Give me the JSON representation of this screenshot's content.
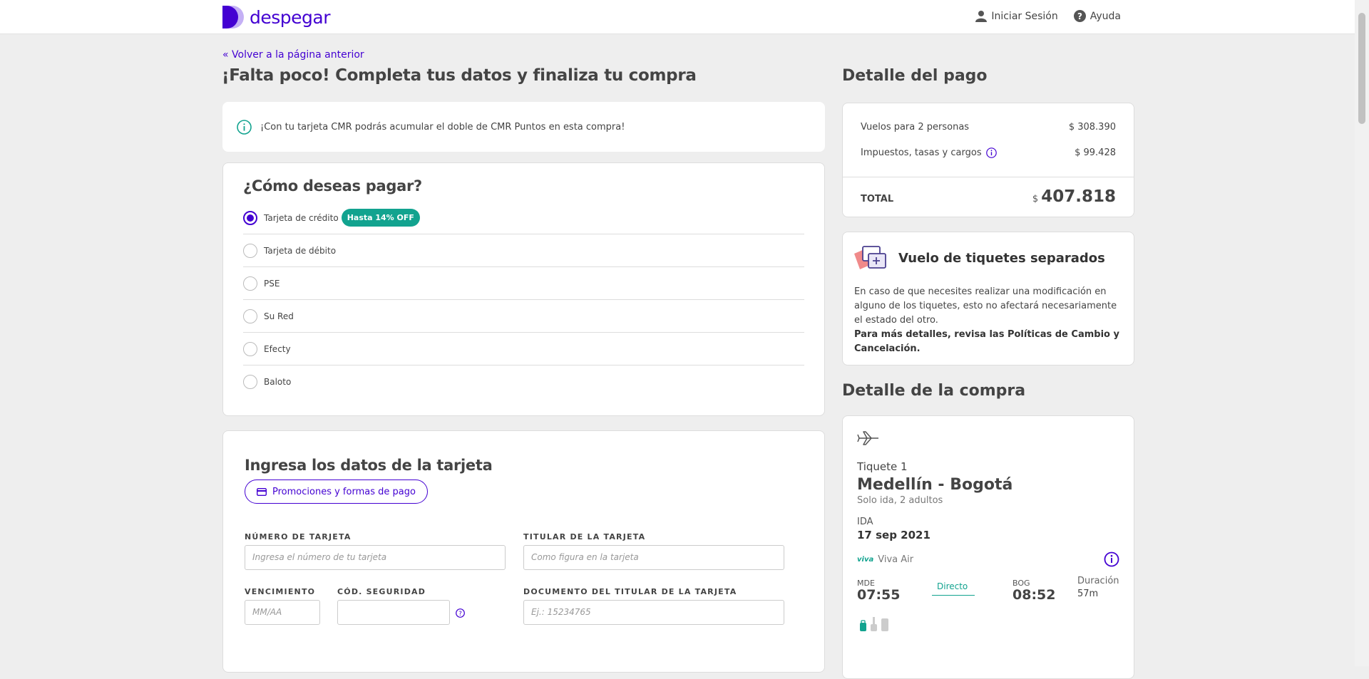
{
  "header": {
    "brand": "despegar",
    "login_label": "Iniciar Sesión",
    "help_label": "Ayuda"
  },
  "back_link": "« Volver a la página anterior",
  "page_title": "¡Falta poco! Completa tus datos y finaliza tu compra",
  "info_banner": "¡Con tu tarjeta CMR podrás acumular el doble de CMR Puntos en esta compra!",
  "payment": {
    "title": "¿Cómo deseas pagar?",
    "options": [
      {
        "label": "Tarjeta de crédito",
        "badge": "Hasta 14% OFF",
        "selected": true
      },
      {
        "label": "Tarjeta de débito",
        "selected": false
      },
      {
        "label": "PSE",
        "selected": false
      },
      {
        "label": "Su Red",
        "selected": false
      },
      {
        "label": "Efecty",
        "selected": false
      },
      {
        "label": "Baloto",
        "selected": false
      }
    ]
  },
  "card_form": {
    "title": "Ingresa los datos de la tarjeta",
    "promo_button": "Promociones y formas de pago",
    "card_number": {
      "label": "NÚMERO DE TARJETA",
      "placeholder": "Ingresa el número de tu tarjeta"
    },
    "holder": {
      "label": "TITULAR DE LA TARJETA",
      "placeholder": "Como figura en la tarjeta"
    },
    "expiry": {
      "label": "VENCIMIENTO",
      "placeholder": "MM/AA"
    },
    "security": {
      "label": "CÓD. SEGURIDAD",
      "placeholder": ""
    },
    "document": {
      "label": "DOCUMENTO DEL TITULAR DE LA TARJETA",
      "placeholder": "Ej.: 15234765"
    }
  },
  "payment_detail": {
    "title": "Detalle del pago",
    "flights_label": "Vuelos para 2 personas",
    "flights_value": "$ 308.390",
    "taxes_label": "Impuestos, tasas y cargos",
    "taxes_value": "$ 99.428",
    "total_label": "TOTAL",
    "total_currency": "$",
    "total_value": "407.818"
  },
  "separate_tickets": {
    "title": "Vuelo de tiquetes separados",
    "body": "En caso de que necesites realizar una modificación en alguno de los tiquetes, esto no afectará necesariamente el estado del otro.",
    "bold": "Para más detalles, revisa las Políticas de Cambio y Cancelación."
  },
  "purchase_detail": {
    "title": "Detalle de la compra",
    "ticket_label": "Tiquete 1",
    "route": "Medellín - Bogotá",
    "trip_info": "Solo ida, 2 adultos",
    "direction": "IDA",
    "date": "17 sep 2021",
    "airline_logo": "viva",
    "airline": "Viva Air",
    "origin_code": "MDE",
    "origin_time": "07:55",
    "stops": "Directo",
    "dest_code": "BOG",
    "dest_time": "08:52",
    "duration_label": "Duración",
    "duration": "57m"
  },
  "colors": {
    "brand": "#4300d2",
    "badge": "#12a38f",
    "background": "#eeeeee"
  }
}
